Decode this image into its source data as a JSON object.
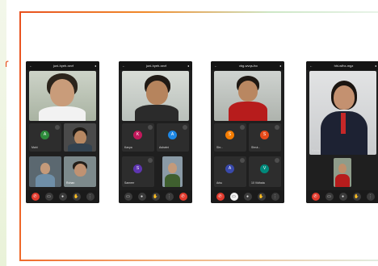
{
  "phones": [
    {
      "status_title": "juni-hyeh-rwvf",
      "tiles": [
        {
          "avatar_letter": "A",
          "avatar_color": "#2e8b3c",
          "name": "Mahi"
        },
        {
          "avatar_letter": "",
          "avatar_color": "",
          "name": ""
        },
        {
          "avatar_letter": "",
          "avatar_color": "",
          "name": ""
        },
        {
          "avatar_letter": "",
          "avatar_color": "",
          "name": "Rohan"
        }
      ]
    },
    {
      "status_title": "juni-hyeh-rwvf",
      "tiles": [
        {
          "avatar_letter": "K",
          "avatar_color": "#c2185b",
          "name": "Kavya"
        },
        {
          "avatar_letter": "A",
          "avatar_color": "#1e88e5",
          "name": "Ashwini"
        },
        {
          "avatar_letter": "S",
          "avatar_color": "#5e35b1",
          "name": "Sameer"
        },
        {
          "avatar_letter": "",
          "avatar_color": "",
          "name": ""
        }
      ]
    },
    {
      "status_title": "vbg-wvqs-fvc",
      "tiles": [
        {
          "avatar_letter": "S",
          "avatar_color": "#f57c00",
          "name": "Shr..."
        },
        {
          "avatar_letter": "S",
          "avatar_color": "#e64a19",
          "name": "Shrut..."
        },
        {
          "avatar_letter": "A",
          "avatar_color": "#3949ab",
          "name": "Arku"
        },
        {
          "avatar_letter": "V",
          "avatar_color": "#00897b",
          "name": "10 Vidhata"
        }
      ]
    },
    {
      "status_title": "hhi-wfhx-mgz",
      "tiles": [
        {
          "avatar_letter": "",
          "avatar_color": "",
          "name": "Kavita"
        }
      ]
    }
  ],
  "controls": {
    "hangup_icon": "call-end-icon",
    "icons": [
      "video-icon",
      "mic-icon",
      "hand-icon",
      "more-icon"
    ]
  },
  "decor_glyph": "ɾ"
}
